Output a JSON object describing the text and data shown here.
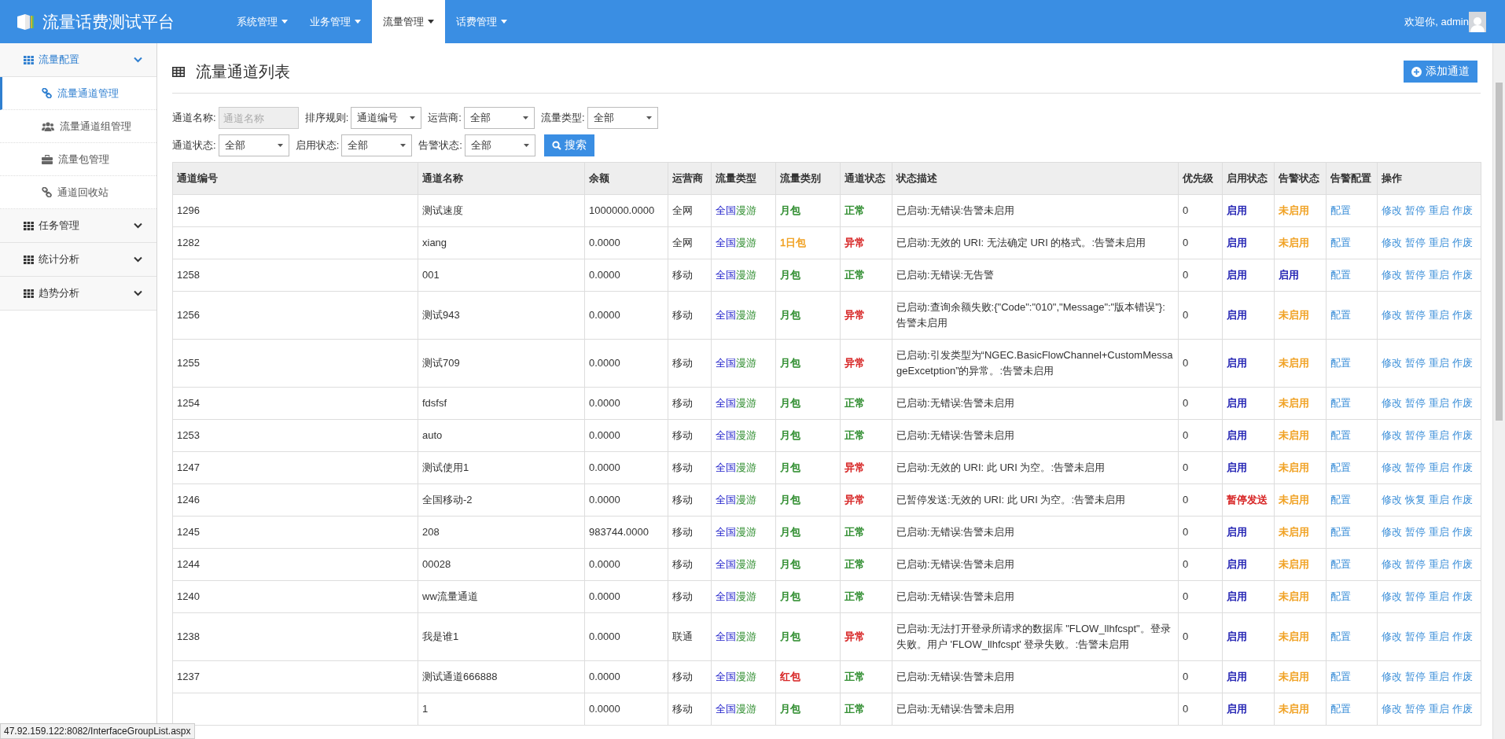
{
  "header": {
    "title": "流量话费测试平台",
    "nav": [
      {
        "label": "系统管理",
        "selected": false
      },
      {
        "label": "业务管理",
        "selected": false
      },
      {
        "label": "流量管理",
        "selected": true
      },
      {
        "label": "话费管理",
        "selected": false
      }
    ],
    "welcome": "欢迎你, admin"
  },
  "sidebar": {
    "groups": [
      {
        "label": "流量配置",
        "expanded": true,
        "children": [
          {
            "label": "流量通道管理",
            "kind": "link",
            "selected": true
          },
          {
            "label": "流量通道组管理",
            "kind": "users",
            "selected": false
          },
          {
            "label": "流量包管理",
            "kind": "briefcase",
            "selected": false
          },
          {
            "label": "通道回收站",
            "kind": "link",
            "selected": false
          }
        ]
      },
      {
        "label": "任务管理",
        "expanded": false
      },
      {
        "label": "统计分析",
        "expanded": false
      },
      {
        "label": "趋势分析",
        "expanded": false
      }
    ]
  },
  "page": {
    "title": "流量通道列表",
    "add_button": "添加通道"
  },
  "filters": {
    "rows": [
      [
        {
          "label": "通道名称:",
          "kind": "text",
          "placeholder": "通道名称"
        },
        {
          "label": "排序规则:",
          "kind": "select",
          "value": "通道编号"
        },
        {
          "label": "运营商:",
          "kind": "select",
          "value": "全部"
        },
        {
          "label": "流量类型:",
          "kind": "select",
          "value": "全部"
        }
      ],
      [
        {
          "label": "通道状态:",
          "kind": "select",
          "value": "全部"
        },
        {
          "label": "启用状态:",
          "kind": "select",
          "value": "全部"
        },
        {
          "label": "告警状态:",
          "kind": "select",
          "value": "全部"
        },
        {
          "label": "搜索",
          "kind": "button"
        }
      ]
    ]
  },
  "table": {
    "columns": [
      "通道编号",
      "通道名称",
      "余额",
      "运营商",
      "流量类型",
      "流量类别",
      "通道状态",
      "状态描述",
      "优先级",
      "启用状态",
      "告警状态",
      "告警配置",
      "操作"
    ],
    "rows": [
      {
        "id": "1296",
        "name": "测试速度",
        "balance": "1000000.0000",
        "carrier": "全网",
        "region": "全国",
        "mode": "漫游",
        "package": {
          "text": "月包",
          "color": "#2a8a2a"
        },
        "state": {
          "text": "正常",
          "color": "#2a8a2a"
        },
        "desc": "已启动:无错误:告警未启用",
        "priority": "0",
        "enabled": {
          "text": "启用",
          "color": "#1a1ab0"
        },
        "alarm": {
          "text": "未启用",
          "color": "#f0a020"
        },
        "config": "配置",
        "ops": [
          "修改",
          "暂停",
          "重启",
          "作废"
        ]
      },
      {
        "id": "1282",
        "name": "xiang",
        "balance": "0.0000",
        "carrier": "全网",
        "region": "全国",
        "mode": "漫游",
        "package": {
          "text": "1日包",
          "color": "#f0a020"
        },
        "state": {
          "text": "异常",
          "color": "#d62020"
        },
        "desc": "已启动:无效的 URI: 无法确定 URI 的格式。:告警未启用",
        "priority": "0",
        "enabled": {
          "text": "启用",
          "color": "#1a1ab0"
        },
        "alarm": {
          "text": "未启用",
          "color": "#f0a020"
        },
        "config": "配置",
        "ops": [
          "修改",
          "暂停",
          "重启",
          "作废"
        ]
      },
      {
        "id": "1258",
        "name": "001",
        "balance": "0.0000",
        "carrier": "移动",
        "region": "全国",
        "mode": "漫游",
        "package": {
          "text": "月包",
          "color": "#2a8a2a"
        },
        "state": {
          "text": "正常",
          "color": "#2a8a2a"
        },
        "desc": "已启动:无错误:无告警",
        "priority": "0",
        "enabled": {
          "text": "启用",
          "color": "#1a1ab0"
        },
        "alarm": {
          "text": "启用",
          "color": "#1a1ab0"
        },
        "config": "配置",
        "ops": [
          "修改",
          "暂停",
          "重启",
          "作废"
        ]
      },
      {
        "id": "1256",
        "name": "测试943",
        "balance": "0.0000",
        "carrier": "移动",
        "region": "全国",
        "mode": "漫游",
        "package": {
          "text": "月包",
          "color": "#2a8a2a"
        },
        "state": {
          "text": "异常",
          "color": "#d62020"
        },
        "desc": "已启动:查询余额失败:{\"Code\":\"010\",\"Message\":\"版本错误\"}:告警未启用",
        "priority": "0",
        "enabled": {
          "text": "启用",
          "color": "#1a1ab0"
        },
        "alarm": {
          "text": "未启用",
          "color": "#f0a020"
        },
        "config": "配置",
        "ops": [
          "修改",
          "暂停",
          "重启",
          "作废"
        ]
      },
      {
        "id": "1255",
        "name": "测试709",
        "balance": "0.0000",
        "carrier": "移动",
        "region": "全国",
        "mode": "漫游",
        "package": {
          "text": "月包",
          "color": "#2a8a2a"
        },
        "state": {
          "text": "异常",
          "color": "#d62020"
        },
        "desc": "已启动:引发类型为“NGEC.BasicFlowChannel+CustomMessageExcetption”的异常。:告警未启用",
        "priority": "0",
        "enabled": {
          "text": "启用",
          "color": "#1a1ab0"
        },
        "alarm": {
          "text": "未启用",
          "color": "#f0a020"
        },
        "config": "配置",
        "ops": [
          "修改",
          "暂停",
          "重启",
          "作废"
        ]
      },
      {
        "id": "1254",
        "name": "fdsfsf",
        "balance": "0.0000",
        "carrier": "移动",
        "region": "全国",
        "mode": "漫游",
        "package": {
          "text": "月包",
          "color": "#2a8a2a"
        },
        "state": {
          "text": "正常",
          "color": "#2a8a2a"
        },
        "desc": "已启动:无错误:告警未启用",
        "priority": "0",
        "enabled": {
          "text": "启用",
          "color": "#1a1ab0"
        },
        "alarm": {
          "text": "未启用",
          "color": "#f0a020"
        },
        "config": "配置",
        "ops": [
          "修改",
          "暂停",
          "重启",
          "作废"
        ]
      },
      {
        "id": "1253",
        "name": "auto",
        "balance": "0.0000",
        "carrier": "移动",
        "region": "全国",
        "mode": "漫游",
        "package": {
          "text": "月包",
          "color": "#2a8a2a"
        },
        "state": {
          "text": "正常",
          "color": "#2a8a2a"
        },
        "desc": "已启动:无错误:告警未启用",
        "priority": "0",
        "enabled": {
          "text": "启用",
          "color": "#1a1ab0"
        },
        "alarm": {
          "text": "未启用",
          "color": "#f0a020"
        },
        "config": "配置",
        "ops": [
          "修改",
          "暂停",
          "重启",
          "作废"
        ]
      },
      {
        "id": "1247",
        "name": "测试使用1",
        "balance": "0.0000",
        "carrier": "移动",
        "region": "全国",
        "mode": "漫游",
        "package": {
          "text": "月包",
          "color": "#2a8a2a"
        },
        "state": {
          "text": "异常",
          "color": "#d62020"
        },
        "desc": "已启动:无效的 URI: 此 URI 为空。:告警未启用",
        "priority": "0",
        "enabled": {
          "text": "启用",
          "color": "#1a1ab0"
        },
        "alarm": {
          "text": "未启用",
          "color": "#f0a020"
        },
        "config": "配置",
        "ops": [
          "修改",
          "暂停",
          "重启",
          "作废"
        ]
      },
      {
        "id": "1246",
        "name": "全国移动-2",
        "balance": "0.0000",
        "carrier": "移动",
        "region": "全国",
        "mode": "漫游",
        "package": {
          "text": "月包",
          "color": "#2a8a2a"
        },
        "state": {
          "text": "异常",
          "color": "#d62020"
        },
        "desc": "已暂停发送:无效的 URI: 此 URI 为空。:告警未启用",
        "priority": "0",
        "enabled": {
          "text": "暂停发送",
          "color": "#d62020"
        },
        "alarm": {
          "text": "未启用",
          "color": "#f0a020"
        },
        "config": "配置",
        "ops": [
          "修改",
          "恢复",
          "重启",
          "作废"
        ]
      },
      {
        "id": "1245",
        "name": "208",
        "balance": "983744.0000",
        "carrier": "移动",
        "region": "全国",
        "mode": "漫游",
        "package": {
          "text": "月包",
          "color": "#2a8a2a"
        },
        "state": {
          "text": "正常",
          "color": "#2a8a2a"
        },
        "desc": "已启动:无错误:告警未启用",
        "priority": "0",
        "enabled": {
          "text": "启用",
          "color": "#1a1ab0"
        },
        "alarm": {
          "text": "未启用",
          "color": "#f0a020"
        },
        "config": "配置",
        "ops": [
          "修改",
          "暂停",
          "重启",
          "作废"
        ]
      },
      {
        "id": "1244",
        "name": "00028",
        "balance": "0.0000",
        "carrier": "移动",
        "region": "全国",
        "mode": "漫游",
        "package": {
          "text": "月包",
          "color": "#2a8a2a"
        },
        "state": {
          "text": "正常",
          "color": "#2a8a2a"
        },
        "desc": "已启动:无错误:告警未启用",
        "priority": "0",
        "enabled": {
          "text": "启用",
          "color": "#1a1ab0"
        },
        "alarm": {
          "text": "未启用",
          "color": "#f0a020"
        },
        "config": "配置",
        "ops": [
          "修改",
          "暂停",
          "重启",
          "作废"
        ]
      },
      {
        "id": "1240",
        "name": "ww流量通道",
        "balance": "0.0000",
        "carrier": "移动",
        "region": "全国",
        "mode": "漫游",
        "package": {
          "text": "月包",
          "color": "#2a8a2a"
        },
        "state": {
          "text": "正常",
          "color": "#2a8a2a"
        },
        "desc": "已启动:无错误:告警未启用",
        "priority": "0",
        "enabled": {
          "text": "启用",
          "color": "#1a1ab0"
        },
        "alarm": {
          "text": "未启用",
          "color": "#f0a020"
        },
        "config": "配置",
        "ops": [
          "修改",
          "暂停",
          "重启",
          "作废"
        ]
      },
      {
        "id": "1238",
        "name": "我是谁1",
        "balance": "0.0000",
        "carrier": "联通",
        "region": "全国",
        "mode": "漫游",
        "package": {
          "text": "月包",
          "color": "#2a8a2a"
        },
        "state": {
          "text": "异常",
          "color": "#d62020"
        },
        "desc": "已启动:无法打开登录所请求的数据库 \"FLOW_llhfcspt\"。登录失败。用户 'FLOW_llhfcspt' 登录失败。:告警未启用",
        "priority": "0",
        "enabled": {
          "text": "启用",
          "color": "#1a1ab0"
        },
        "alarm": {
          "text": "未启用",
          "color": "#f0a020"
        },
        "config": "配置",
        "ops": [
          "修改",
          "暂停",
          "重启",
          "作废"
        ]
      },
      {
        "id": "1237",
        "name": "测试通道666888",
        "balance": "0.0000",
        "carrier": "移动",
        "region": "全国",
        "mode": "漫游",
        "package": {
          "text": "红包",
          "color": "#d62020"
        },
        "state": {
          "text": "正常",
          "color": "#2a8a2a"
        },
        "desc": "已启动:无错误:告警未启用",
        "priority": "0",
        "enabled": {
          "text": "启用",
          "color": "#1a1ab0"
        },
        "alarm": {
          "text": "未启用",
          "color": "#f0a020"
        },
        "config": "配置",
        "ops": [
          "修改",
          "暂停",
          "重启",
          "作废"
        ]
      },
      {
        "name": "1",
        "balance": "0.0000",
        "carrier": "移动",
        "region": "全国",
        "mode": "漫游",
        "package": {
          "text": "月包",
          "color": "#2a8a2a"
        },
        "state": {
          "text": "正常",
          "color": "#2a8a2a"
        },
        "desc": "已启动:无错误:告警未启用",
        "priority": "0",
        "enabled": {
          "text": "启用",
          "color": "#1a1ab0"
        },
        "alarm": {
          "text": "未启用",
          "color": "#f0a020"
        },
        "config": "配置",
        "ops": [
          "修改",
          "暂停",
          "重启",
          "作废"
        ]
      }
    ]
  },
  "status_url": "47.92.159.122:8082/InterfaceGroupList.aspx"
}
